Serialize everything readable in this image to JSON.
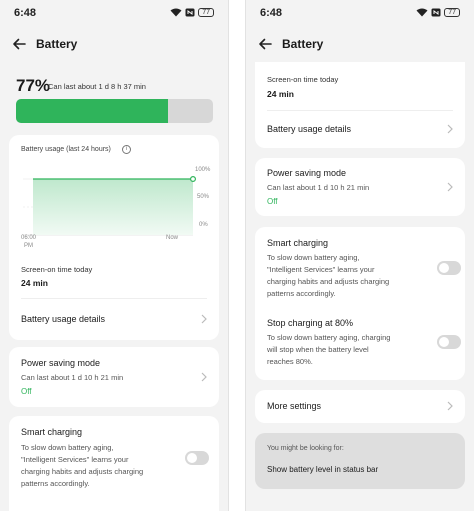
{
  "status_bar": {
    "time": "6:48",
    "battery": "77"
  },
  "header": {
    "title": "Battery"
  },
  "battery": {
    "percent": "77%",
    "estimate": "Can last about 1 d 8 h 37 min",
    "level": 0.77,
    "fill_color": "#2fb45b"
  },
  "usage": {
    "title": "Battery usage (last 24 hours)",
    "y_ticks": [
      "100%",
      "50%",
      "0%"
    ],
    "x_start": "06:00",
    "x_start_suffix": "PM",
    "x_end": "Now"
  },
  "chart_data": {
    "type": "area",
    "x": [
      "06:00 PM",
      "Now"
    ],
    "values": [
      100,
      100
    ],
    "ylim": [
      0,
      100
    ],
    "y_ticks": [
      "100%",
      "50%",
      "0%"
    ],
    "xlabel": "",
    "ylabel": "",
    "grid": true
  },
  "screen_on": {
    "label": "Screen-on time today",
    "value": "24 min"
  },
  "usage_details": {
    "label": "Battery usage details"
  },
  "power_saving": {
    "label": "Power saving mode",
    "estimate": "Can last about 1 d 10 h 21 min",
    "state": "Off"
  },
  "smart_charging": {
    "label": "Smart charging",
    "description": "To slow down battery aging, \"Intelligent Services\" learns your charging habits and adjusts charging patterns accordingly.",
    "lines": [
      "To slow down battery aging,",
      "\"Intelligent Services\" learns your",
      "charging habits and adjusts charging",
      "patterns accordingly."
    ],
    "enabled": false
  },
  "stop_charging": {
    "label": "Stop charging at 80%",
    "lines": [
      "To slow down battery aging, charging",
      "will stop when the battery level",
      "reaches 80%."
    ],
    "enabled": false
  },
  "more_settings": {
    "label": "More settings"
  },
  "suggestions": {
    "heading": "You might be looking for:",
    "item": "Show battery level in status bar"
  }
}
